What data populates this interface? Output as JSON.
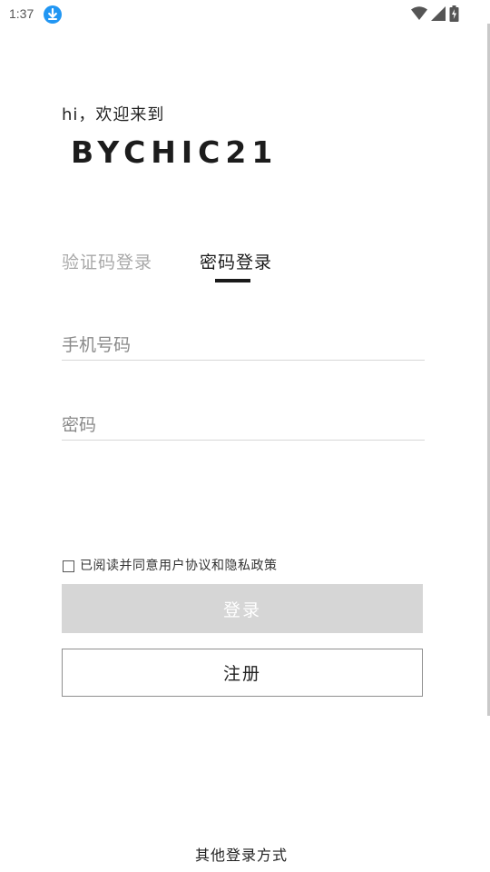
{
  "status_bar": {
    "time": "1:37",
    "icons": [
      "download-icon",
      "wifi-icon",
      "signal-icon",
      "battery-icon"
    ]
  },
  "welcome": {
    "greeting": "hi，欢迎来到",
    "brand": "BYCHIC21"
  },
  "tabs": [
    {
      "label": "验证码登录",
      "active": false
    },
    {
      "label": "密码登录",
      "active": true
    }
  ],
  "form": {
    "phone_placeholder": "手机号码",
    "phone_value": "",
    "password_placeholder": "密码",
    "password_value": ""
  },
  "agreement": {
    "text": "已阅读并同意用户协议和隐私政策",
    "checked": false
  },
  "buttons": {
    "login_label": "登录",
    "register_label": "注册"
  },
  "footer": {
    "other_login_label": "其他登录方式"
  },
  "colors": {
    "accent": "#1a1a1a",
    "inactive_tab": "#a8a8a8",
    "disabled_button": "#d6d6d6",
    "download_badge": "#2196f3"
  }
}
